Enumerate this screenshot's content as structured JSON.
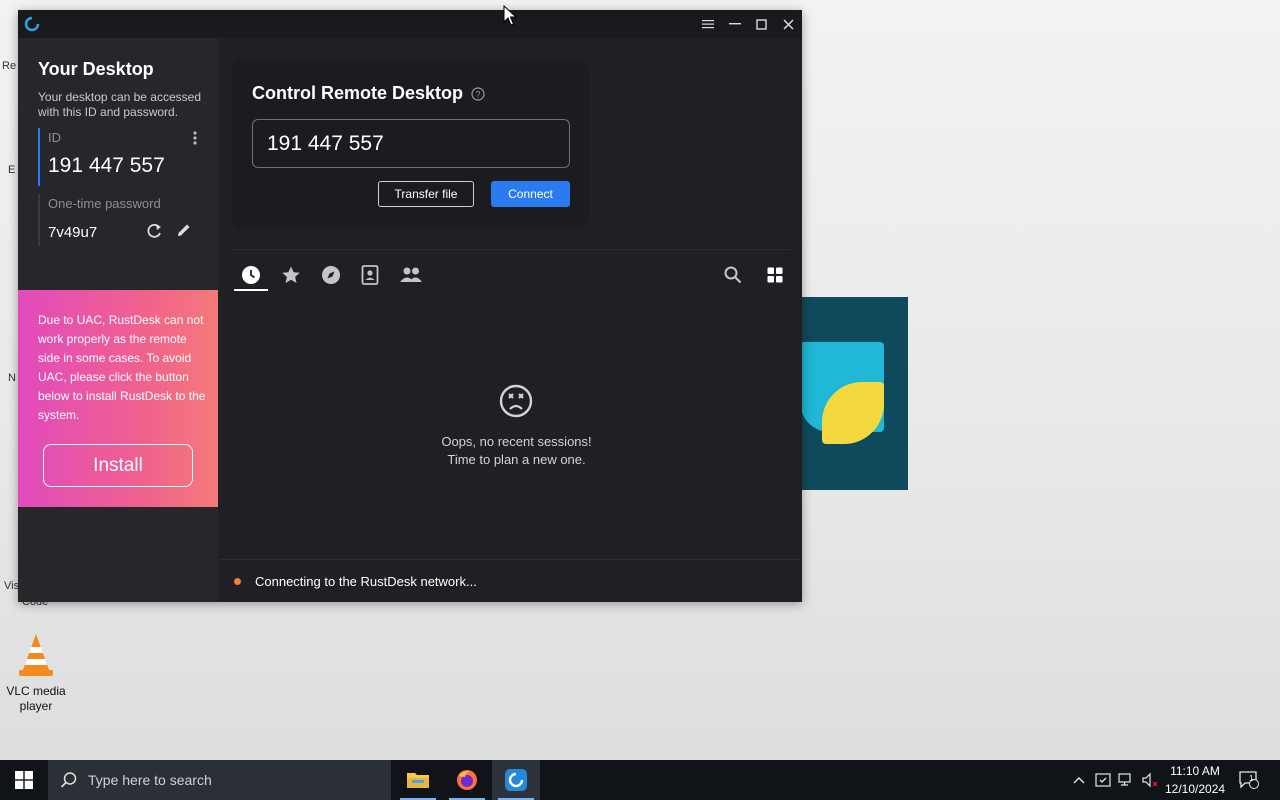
{
  "desktop": {
    "vlc_label": "VLC media player",
    "partial_labels": [
      "Re",
      "E",
      "N",
      "Vis",
      "Code"
    ]
  },
  "window": {
    "menu_icon": "hamburger-icon",
    "minimize_icon": "minimize-icon",
    "maximize_icon": "maximize-icon",
    "close_icon": "close-icon"
  },
  "sidebar": {
    "title": "Your Desktop",
    "description": "Your desktop can be accessed with this ID and password.",
    "id_label": "ID",
    "id_value": "191 447 557",
    "password_label": "One-time password",
    "password_value": "7v49u7",
    "uac_message": "Due to UAC, RustDesk can not work properly as the remote side in some cases. To avoid UAC, please click the button below to install RustDesk to the system.",
    "install_label": "Install"
  },
  "connect": {
    "title": "Control Remote Desktop",
    "id_input_value": "191 447 557",
    "transfer_label": "Transfer file",
    "connect_label": "Connect"
  },
  "tabs": [
    {
      "name": "recent-sessions",
      "icon": "clock-icon",
      "active": true
    },
    {
      "name": "favorites",
      "icon": "star-icon"
    },
    {
      "name": "discovered",
      "icon": "compass-icon"
    },
    {
      "name": "address-book",
      "icon": "contacts-icon"
    },
    {
      "name": "group",
      "icon": "people-icon"
    }
  ],
  "empty_state": {
    "line1": "Oops, no recent sessions!",
    "line2": "Time to plan a new one."
  },
  "status": {
    "text": "Connecting to the RustDesk network...",
    "color": "#f0813a"
  },
  "taskbar": {
    "search_placeholder": "Type here to search",
    "time": "11:10 AM",
    "date": "12/10/2024",
    "notification_count": "1"
  },
  "colors": {
    "accent": "#2b7bf0",
    "window_bg": "#1f1f24",
    "uac_gradient_start": "#e04bbd",
    "uac_gradient_end": "#f47a78"
  }
}
